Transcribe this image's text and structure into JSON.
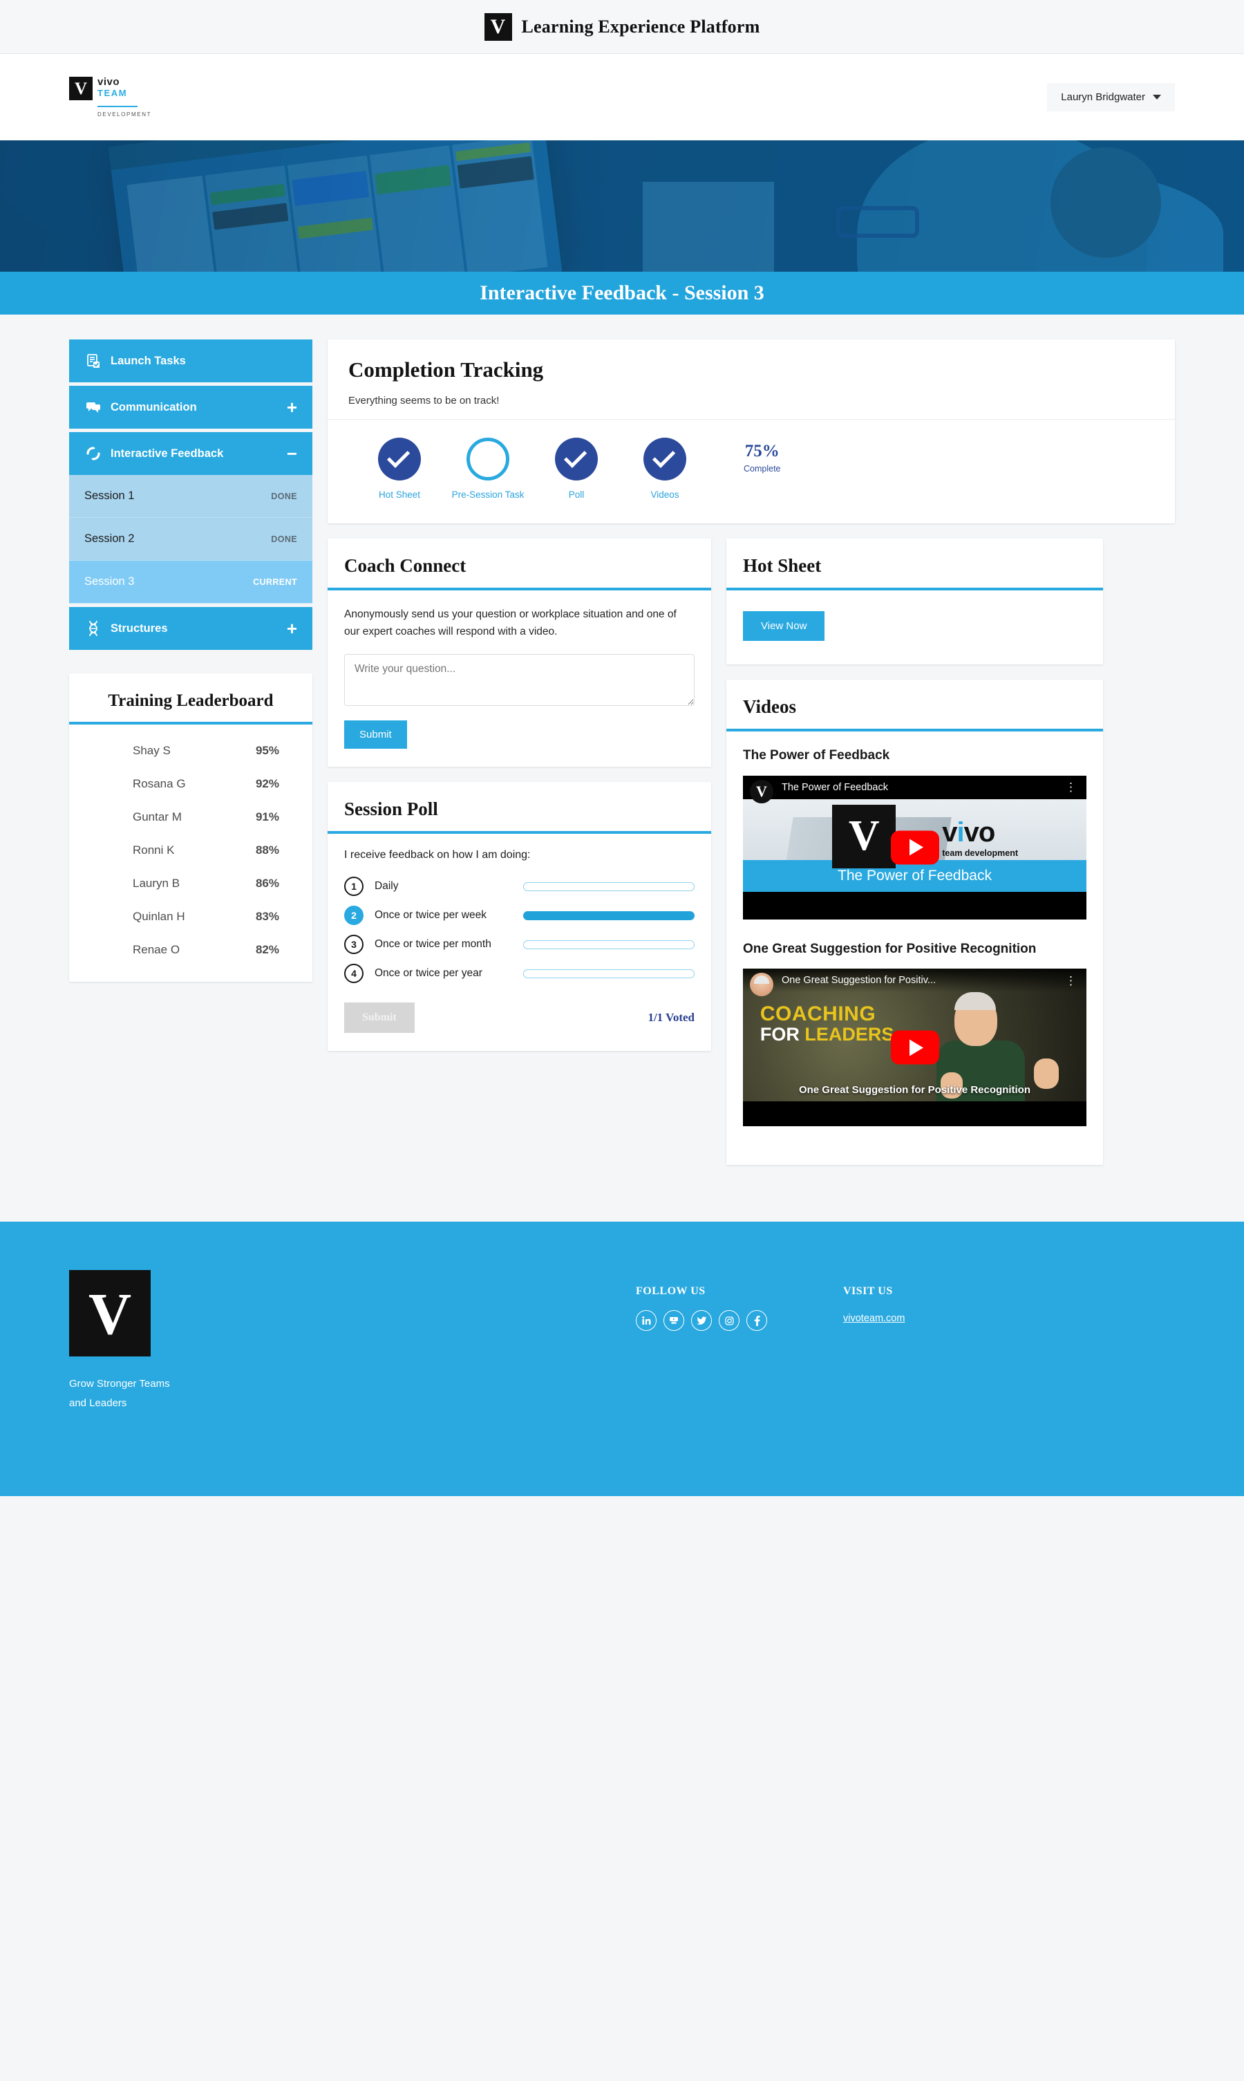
{
  "topbar": {
    "logo_letter": "V",
    "title": "Learning Experience Platform"
  },
  "header": {
    "brand": {
      "mark": "V",
      "name": "vivo",
      "team": "TEAM",
      "development": "DEVELOPMENT"
    },
    "user": {
      "name": "Lauryn Bridgwater",
      "caret_icon": "chevron-down-icon"
    }
  },
  "hero": {
    "banner_title": "Interactive Feedback - Session 3"
  },
  "sidebar": {
    "items": [
      {
        "label": "Launch Tasks",
        "icon": "clipboard-check-icon",
        "sign": ""
      },
      {
        "label": "Communication",
        "icon": "chat-bubbles-icon",
        "sign": "+"
      },
      {
        "label": "Interactive Feedback",
        "icon": "refresh-circle-icon",
        "sign": "−"
      },
      {
        "label": "Structures",
        "icon": "dna-icon",
        "sign": "+"
      }
    ],
    "sessions": [
      {
        "label": "Session 1",
        "status": "DONE",
        "current": false
      },
      {
        "label": "Session 2",
        "status": "DONE",
        "current": false
      },
      {
        "label": "Session 3",
        "status": "CURRENT",
        "current": true
      }
    ]
  },
  "leaderboard": {
    "title": "Training Leaderboard",
    "rows": [
      {
        "name": "Shay S",
        "score": "95%"
      },
      {
        "name": "Rosana G",
        "score": "92%"
      },
      {
        "name": "Guntar M",
        "score": "91%"
      },
      {
        "name": "Ronni K",
        "score": "88%"
      },
      {
        "name": "Lauryn B",
        "score": "86%"
      },
      {
        "name": "Quinlan H",
        "score": "83%"
      },
      {
        "name": "Renae O",
        "score": "82%"
      }
    ]
  },
  "completion": {
    "title": "Completion Tracking",
    "subtitle": "Everything seems to be on track!",
    "steps": [
      {
        "label": "Hot Sheet",
        "done": true
      },
      {
        "label": "Pre-Session Task",
        "done": false
      },
      {
        "label": "Poll",
        "done": true
      },
      {
        "label": "Videos",
        "done": true
      }
    ],
    "percent": "75%",
    "percent_label": "Complete"
  },
  "coach_connect": {
    "title": "Coach Connect",
    "description": "Anonymously send us your question or workplace situation and one of our expert coaches will respond with a video.",
    "placeholder": "Write your question...",
    "value": "",
    "submit_label": "Submit"
  },
  "session_poll": {
    "title": "Session Poll",
    "question": "I receive feedback on how I am doing:",
    "options": [
      {
        "num": "1",
        "label": "Daily",
        "selected": false
      },
      {
        "num": "2",
        "label": "Once or twice per week",
        "selected": true
      },
      {
        "num": "3",
        "label": "Once or twice per month",
        "selected": false
      },
      {
        "num": "4",
        "label": "Once or twice per year",
        "selected": false
      }
    ],
    "submit_label": "Submit",
    "voted_label": "1/1 Voted"
  },
  "hot_sheet": {
    "title": "Hot Sheet",
    "button_label": "View Now"
  },
  "videos": {
    "title": "Videos",
    "items": [
      {
        "title": "The Power of Feedback",
        "player_title": "The Power of Feedback",
        "caption": "The Power of Feedback",
        "channel_mark": "V",
        "play_icon": "youtube-play-icon",
        "menu_icon": "kebab-menu-icon"
      },
      {
        "title": "One Great Suggestion for Positive Recognition",
        "player_title": "One Great Suggestion for Positiv...",
        "caption": "One Great Suggestion for Positive Recognition",
        "overlay_line1": "COACHING",
        "overlay_line2_white": "FOR ",
        "overlay_line2_yellow": "LEADERS",
        "play_icon": "youtube-play-icon",
        "menu_icon": "kebab-menu-icon"
      }
    ]
  },
  "footer": {
    "logo_letter": "V",
    "tagline_line1": "Grow Stronger Teams",
    "tagline_line2": "and Leaders",
    "follow_title": "FOLLOW US",
    "socials": [
      {
        "icon": "linkedin-icon",
        "glyph": "in"
      },
      {
        "icon": "youtube-icon",
        "glyph": "▶"
      },
      {
        "icon": "twitter-icon",
        "glyph": "🐦"
      },
      {
        "icon": "instagram-icon",
        "glyph": "◎"
      },
      {
        "icon": "facebook-icon",
        "glyph": "f"
      }
    ],
    "visit_title": "VISIT US",
    "visit_link": "vivoteam.com"
  },
  "colors": {
    "brand_blue": "#29a9e0",
    "navy": "#2b4a9b",
    "sub_light": "#a9d5ef",
    "sub_current": "#7fcbf5",
    "page_bg": "#f4f6f8"
  }
}
